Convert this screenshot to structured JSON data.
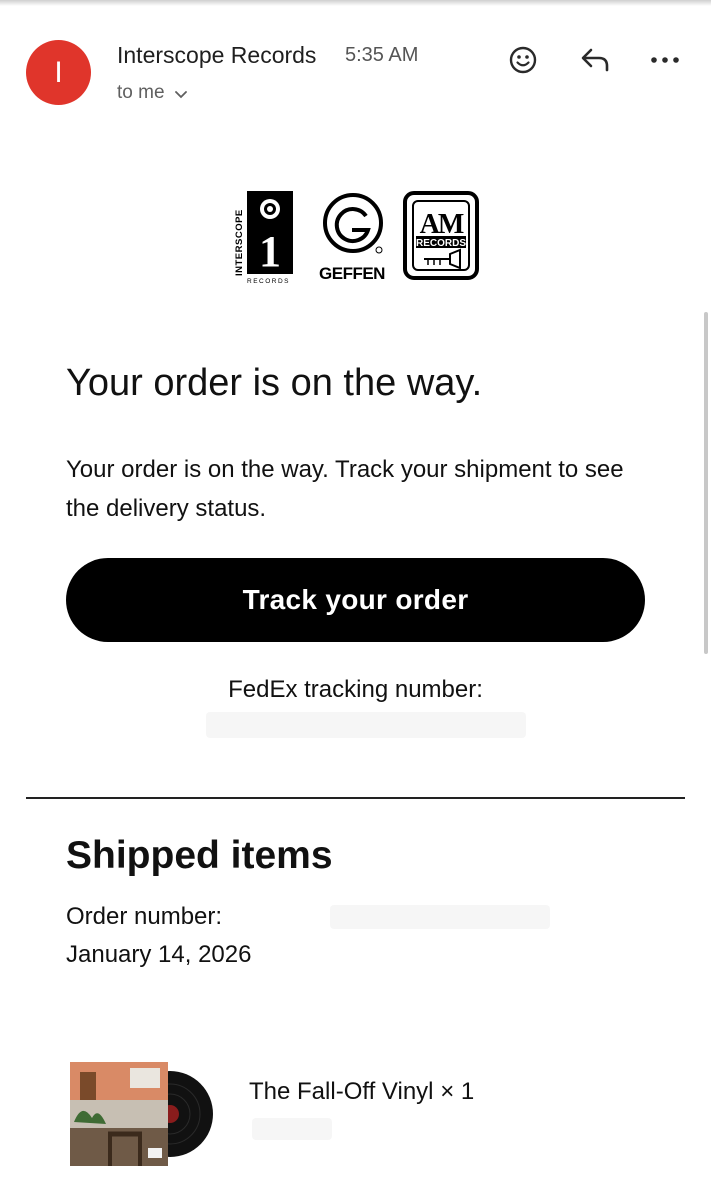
{
  "email": {
    "sender_initial": "I",
    "sender": "Interscope Records",
    "time": "5:35 AM",
    "recipient": "to me",
    "accent_color": "#e0352b"
  },
  "icons": {
    "emoji": "smiley-icon",
    "reply": "reply-icon",
    "more": "more-icon"
  },
  "logos": {
    "interscope": {
      "vertical": "INTERSCOPE",
      "bottom": "RECORDS",
      "numeral": "1"
    },
    "geffen": {
      "text": "GEFFEN"
    },
    "am": {
      "letters": "AM",
      "text": "RECORDS"
    }
  },
  "message": {
    "headline": "Your order is on the way.",
    "body": "Your order is on the way. Track your shipment to see the delivery status.",
    "button_label": "Track your order",
    "tracking_label": "FedEx tracking number:"
  },
  "shipped": {
    "title": "Shipped items",
    "order_label": "Order number:",
    "order_date": "January 14, 2026",
    "items": [
      {
        "name": "The Fall-Off Vinyl",
        "quantity": "× 1"
      }
    ]
  }
}
